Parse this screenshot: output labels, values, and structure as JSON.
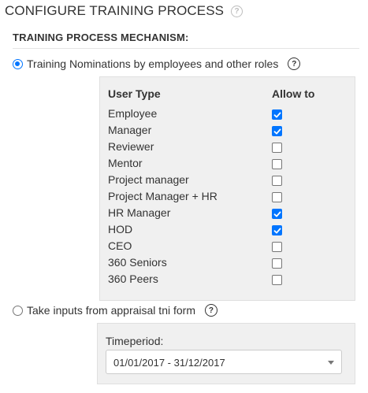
{
  "page": {
    "title": "CONFIGURE TRAINING PROCESS",
    "help_icon": "question-circle-icon"
  },
  "section": {
    "heading": "TRAINING PROCESS MECHANISM:"
  },
  "options": [
    {
      "label": "Training Nominations by employees and other roles",
      "selected": true
    },
    {
      "label": "Take inputs from appraisal tni form",
      "selected": false
    }
  ],
  "roles_table": {
    "col_user_type": "User Type",
    "col_allow_to": "Allow to",
    "rows": [
      {
        "name": "Employee",
        "allowed": true
      },
      {
        "name": "Manager",
        "allowed": true
      },
      {
        "name": "Reviewer",
        "allowed": false
      },
      {
        "name": "Mentor",
        "allowed": false
      },
      {
        "name": "Project manager",
        "allowed": false
      },
      {
        "name": "Project Manager + HR",
        "allowed": false
      },
      {
        "name": "HR Manager",
        "allowed": true
      },
      {
        "name": "HOD",
        "allowed": true
      },
      {
        "name": "CEO",
        "allowed": false
      },
      {
        "name": "360 Seniors",
        "allowed": false
      },
      {
        "name": "360 Peers",
        "allowed": false
      }
    ]
  },
  "timeperiod": {
    "label": "Timeperiod:",
    "selected": "01/01/2017 - 31/12/2017"
  },
  "colors": {
    "accent": "#0075ff",
    "panel_bg": "#f0f0f0",
    "text": "#333333"
  }
}
